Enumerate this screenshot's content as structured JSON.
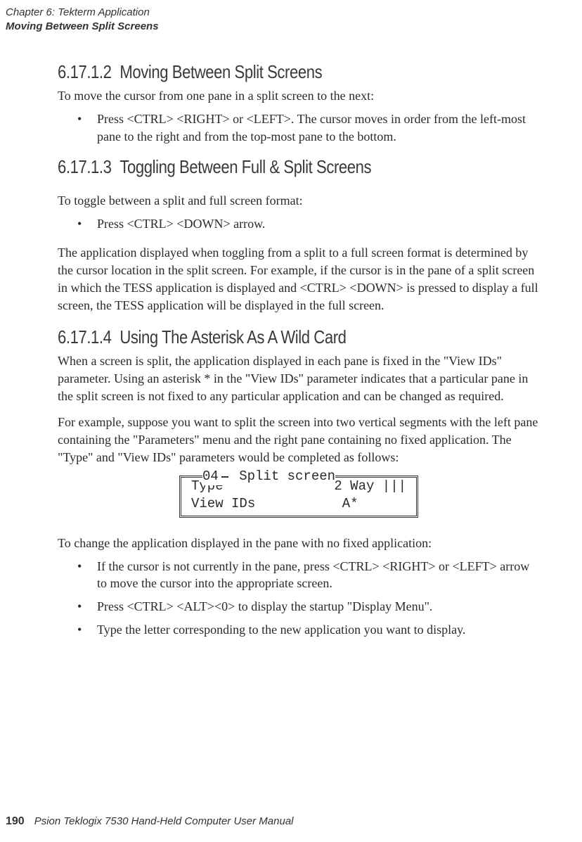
{
  "header": {
    "chapter": "Chapter 6: Tekterm Application",
    "section": "Moving Between Split Screens"
  },
  "s1": {
    "num": "6.17.1.2",
    "title": "Moving Between Split Screens",
    "intro": "To move the cursor from one pane in a split screen to the next:",
    "b1": "Press <CTRL> <RIGHT> or <LEFT>. The cursor moves in order from the left-most pane to the right and from the top-most pane to the bottom."
  },
  "s2": {
    "num": "6.17.1.3",
    "title": "Toggling Between Full & Split Screens",
    "intro": "To toggle between a split and full screen format:",
    "b1": "Press <CTRL> <DOWN> arrow.",
    "p1": "The application displayed when toggling from a split to a full screen format is determined by the cursor location in the split screen. For example, if the cursor is in the pane of a split screen in which the TESS application is displayed and <CTRL> <DOWN> is pressed to display a full screen, the TESS application will be displayed in the full screen."
  },
  "s3": {
    "num": "6.17.1.4",
    "title": "Using The Asterisk As A Wild Card",
    "p1": "When a screen is split, the application displayed in each pane is fixed in the \"View IDs\" parameter. Using an asterisk * in the \"View IDs\" parameter indicates that a particular pane in the split screen is not fixed to any particular application and can be changed as required.",
    "p2": "For example, suppose you want to split the screen into two vertical segments with the left pane containing the \"Parameters\" menu and the right pane containing no fixed application. The \"Type\" and \"View IDs\" parameters would be completed as follows:",
    "p3": "To change the application displayed in the pane with no fixed application:",
    "b1": "If the cursor is not currently in the pane, press <CTRL> <RIGHT> or <LEFT> arrow to move the cursor into the appropriate screen.",
    "b2": "Press <CTRL> <ALT><0> to display the startup \"Display Menu\".",
    "b3": "Type the letter corresponding to the new application you want to display."
  },
  "box": {
    "legend": "Split screen",
    "legend_num": "04",
    "r1l": "Type",
    "r1r": "2 Way |||",
    "r2l": "View IDs",
    "r2r": "A*      "
  },
  "footer": {
    "page": "190",
    "text": "Psion Teklogix 7530 Hand-Held Computer User Manual"
  }
}
